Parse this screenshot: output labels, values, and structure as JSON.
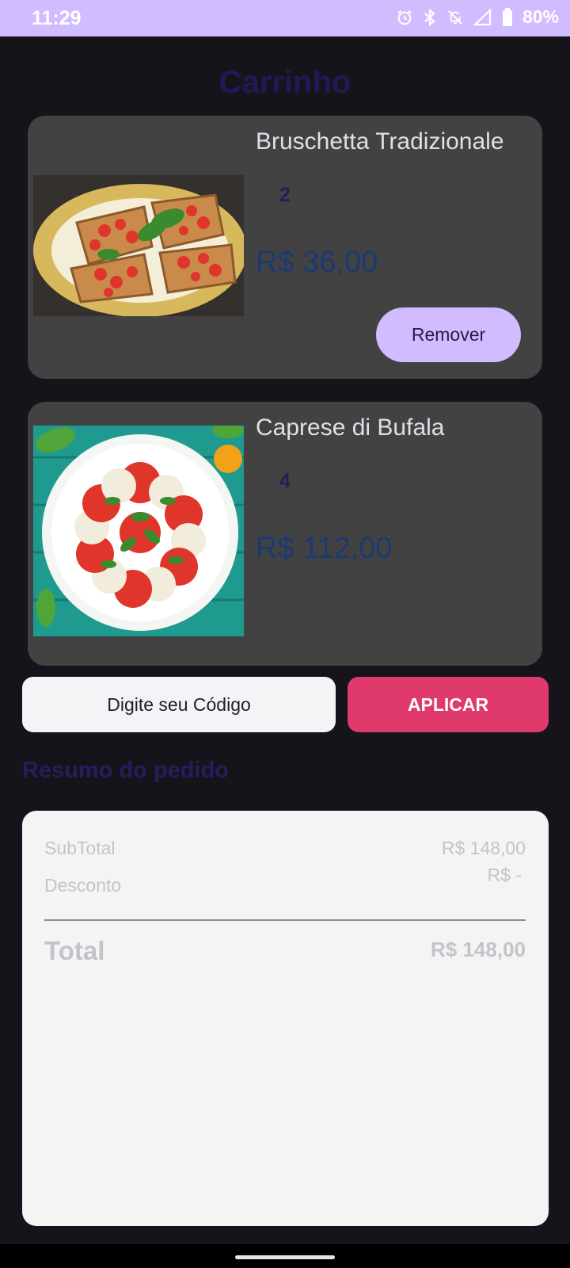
{
  "status_bar": {
    "time": "11:29",
    "battery": "80%",
    "icons": [
      "alarm-icon",
      "bluetooth-icon",
      "notifications-off-icon",
      "signal-icon",
      "battery-icon"
    ],
    "background": "#d0bcfe"
  },
  "page": {
    "title": "Carrinho"
  },
  "cart": {
    "items": [
      {
        "name": "Bruschetta Tradizionale",
        "quantity": "2",
        "price": "R$ 36,00",
        "remove_label": "Remover",
        "image": "bruschetta-photo"
      },
      {
        "name": "Caprese di Bufala",
        "quantity": "4",
        "price": "R$ 112,00",
        "image": "caprese-photo"
      }
    ]
  },
  "coupon": {
    "placeholder": "Digite seu Código",
    "apply_label": "APLICAR"
  },
  "summary": {
    "heading": "Resumo do pedido",
    "subtotal_label": "SubTotal",
    "subtotal_value": "R$ 148,00",
    "discount_label": "Desconto",
    "discount_value": "R$ -",
    "total_label": "Total",
    "total_value": "R$ 148,00"
  },
  "colors": {
    "accent": "#d0bcfe",
    "apply_button": "#e0396c",
    "card_background": "#424242",
    "background": "#16141b"
  }
}
